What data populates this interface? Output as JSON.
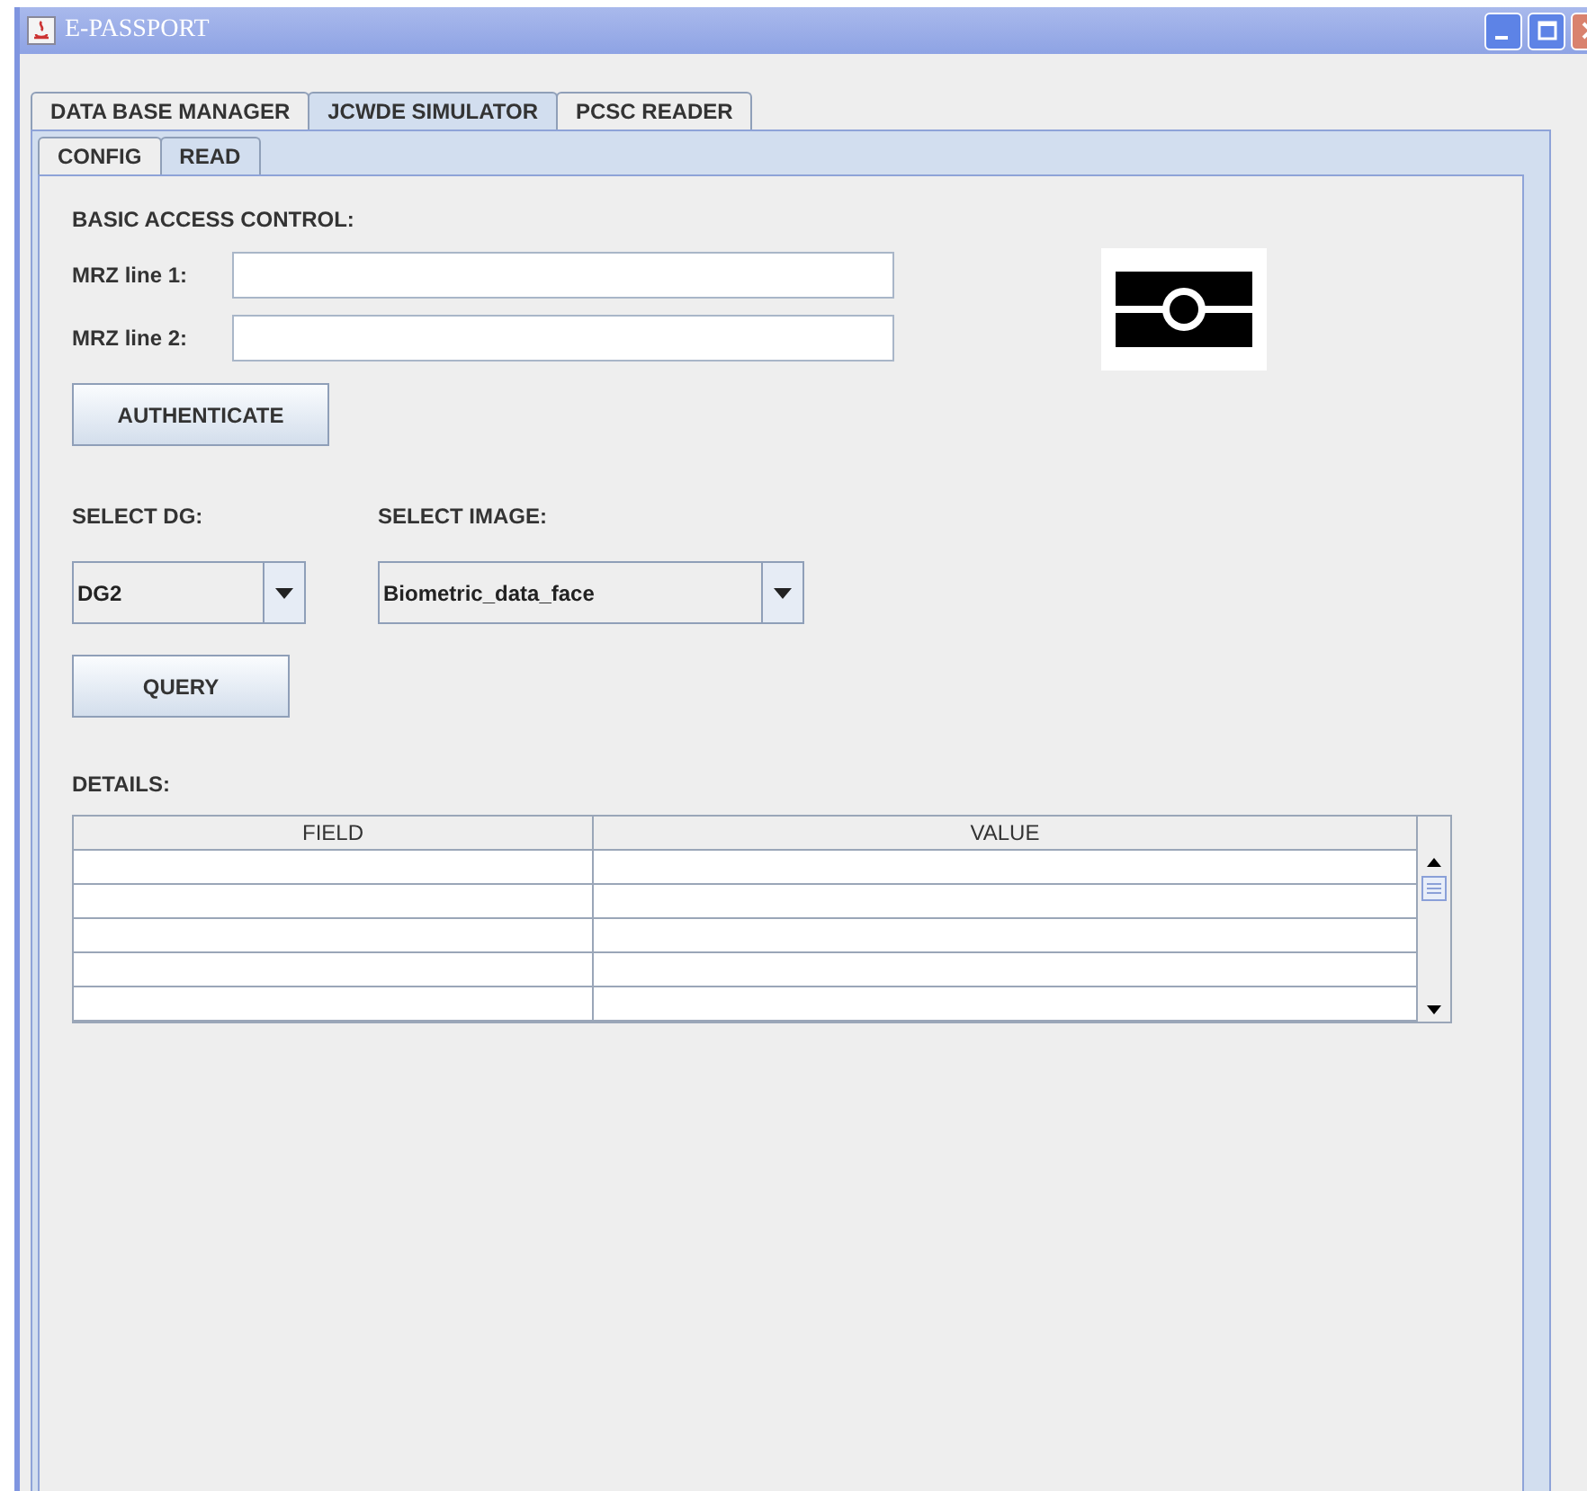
{
  "window": {
    "title": "E-PASSPORT"
  },
  "tabs": [
    {
      "label": "DATA BASE MANAGER",
      "selected": false
    },
    {
      "label": "JCWDE SIMULATOR",
      "selected": true
    },
    {
      "label": "PCSC READER",
      "selected": false
    }
  ],
  "subtabs": [
    {
      "label": "CONFIG",
      "selected": false
    },
    {
      "label": "READ",
      "selected": true
    }
  ],
  "bac": {
    "heading": "BASIC ACCESS CONTROL:",
    "fields": [
      {
        "label": "MRZ line 1:"
      },
      {
        "label": "MRZ line 2:"
      }
    ],
    "button": "AUTHENTICATE"
  },
  "select_dg": {
    "label": "SELECT DG:",
    "value": "DG2"
  },
  "select_image": {
    "label": "SELECT IMAGE:",
    "value": "Biometric_data_face"
  },
  "query_button": "QUERY",
  "details": {
    "heading": "DETAILS:",
    "columns": [
      "FIELD",
      "VALUE"
    ]
  }
}
